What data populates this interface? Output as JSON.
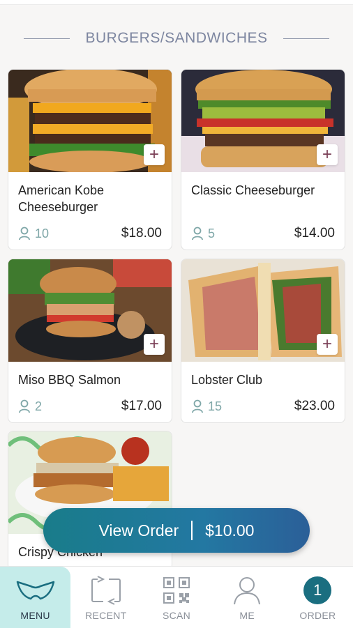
{
  "section": {
    "title": "BURGERS/SANDWICHES"
  },
  "items": [
    {
      "name": "American Kobe Cheeseburger",
      "likes": "10",
      "price": "$18.00"
    },
    {
      "name": "Classic Cheeseburger",
      "likes": "5",
      "price": "$14.00"
    },
    {
      "name": "Miso BBQ Salmon",
      "likes": "2",
      "price": "$17.00"
    },
    {
      "name": "Lobster Club",
      "likes": "15",
      "price": "$23.00"
    },
    {
      "name": "Crispy Chicken"
    }
  ],
  "view_order": {
    "label": "View Order",
    "amount": "$10.00"
  },
  "nav": {
    "menu": "MENU",
    "recent": "RECENT",
    "scan": "SCAN",
    "me": "ME",
    "order": "ORDER",
    "order_count": "1"
  },
  "colors": {
    "accent": "#1a6e80",
    "active_tab": "#c5ecea",
    "likes": "#7fa7a8",
    "add_icon": "#7a3f56"
  },
  "icons": {
    "add": "plus-icon",
    "likes": "person-icon",
    "menu": "bowtie-menu-icon",
    "recent": "recent-arrows-icon",
    "scan": "qr-code-icon",
    "me": "user-icon"
  }
}
